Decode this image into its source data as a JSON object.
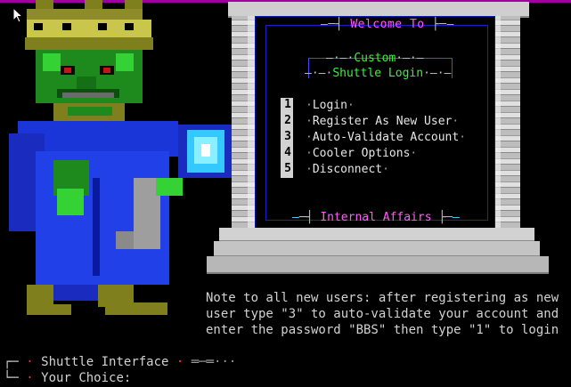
{
  "panel": {
    "welcome_a": "W",
    "welcome_b": "elcome ",
    "welcome_c": "T",
    "welcome_d": "o",
    "custom": "Custom",
    "shuttle": "Shuttle Login",
    "bottom_title": "Internal Affairs"
  },
  "menu": [
    {
      "num": "1",
      "label": "Login"
    },
    {
      "num": "2",
      "label": "Register As New User"
    },
    {
      "num": "3",
      "label": "Auto-Validate Account"
    },
    {
      "num": "4",
      "label": "Cooler Options"
    },
    {
      "num": "5",
      "label": "Disconnect"
    }
  ],
  "note": {
    "line1": "Note to all new users: after registering as new",
    "line2": "user type \"3\" to auto-validate your account and",
    "line3": "enter the password \"BBS\" then type \"1\" to login"
  },
  "prompt": {
    "interface": "Shuttle Interface",
    "choice_label": "Your Choice:"
  },
  "colors": {
    "accent_magenta": "#ff5cff",
    "accent_green": "#3df03d",
    "panel_blue": "#1e1ec8",
    "stone": "#c8c8c8"
  },
  "icons": [
    "mouse-pointer-icon",
    "wizard-character-art",
    "crystal-orb-icon"
  ]
}
